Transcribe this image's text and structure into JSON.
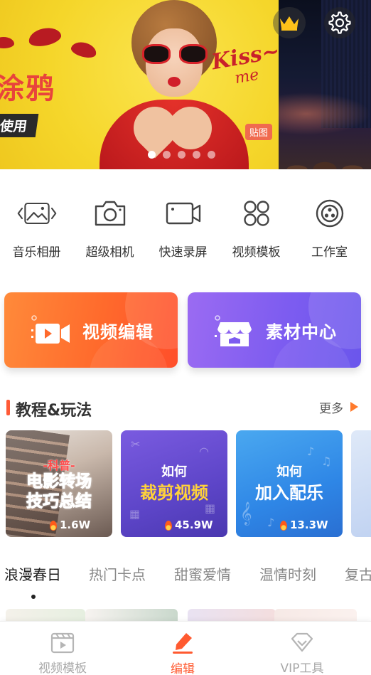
{
  "banner": {
    "slide_title": "涂鸦",
    "slide_subtitle": "使用",
    "slide_art_text_line1": "Kiss~",
    "slide_art_text_line2": "me",
    "sticker_tag": "贴图",
    "dot_count": 5,
    "active_dot": 0,
    "crown_icon": "crown-icon",
    "settings_icon": "gear-icon"
  },
  "tools": [
    {
      "label": "音乐相册",
      "icon": "music-album-icon"
    },
    {
      "label": "超级相机",
      "icon": "camera-icon"
    },
    {
      "label": "快速录屏",
      "icon": "screen-record-icon"
    },
    {
      "label": "视频模板",
      "icon": "template-grid-icon"
    },
    {
      "label": "工作室",
      "icon": "studio-icon"
    }
  ],
  "cards": {
    "edit": {
      "label": "视频编辑",
      "icon": "video-edit-icon"
    },
    "material": {
      "label": "素材中心",
      "icon": "store-icon"
    }
  },
  "tutorials": {
    "title": "教程&玩法",
    "more": "更多",
    "items": [
      {
        "line1": "-科普-",
        "line2": "电影转场",
        "line3": "技巧总结",
        "views": "1.6W"
      },
      {
        "line1": "如何",
        "line2": "裁剪视频",
        "views": "45.9W"
      },
      {
        "line1": "如何",
        "line2": "加入配乐",
        "views": "13.3W"
      }
    ]
  },
  "categories": [
    {
      "label": "浪漫春日",
      "active": true
    },
    {
      "label": "热门卡点",
      "active": false
    },
    {
      "label": "甜蜜爱情",
      "active": false
    },
    {
      "label": "温情时刻",
      "active": false
    },
    {
      "label": "复古",
      "active": false
    }
  ],
  "bottom_nav": [
    {
      "label": "视频模板",
      "icon": "film-template-icon",
      "active": false
    },
    {
      "label": "编辑",
      "icon": "edit-pencil-icon",
      "active": true
    },
    {
      "label": "VIP工具",
      "icon": "vip-diamond-icon",
      "active": false
    }
  ],
  "colors": {
    "accent": "#ff5a30",
    "edit_card": "#ff6a2c",
    "material_card": "#7d5cf0",
    "inactive_text": "#a8a8a8"
  }
}
